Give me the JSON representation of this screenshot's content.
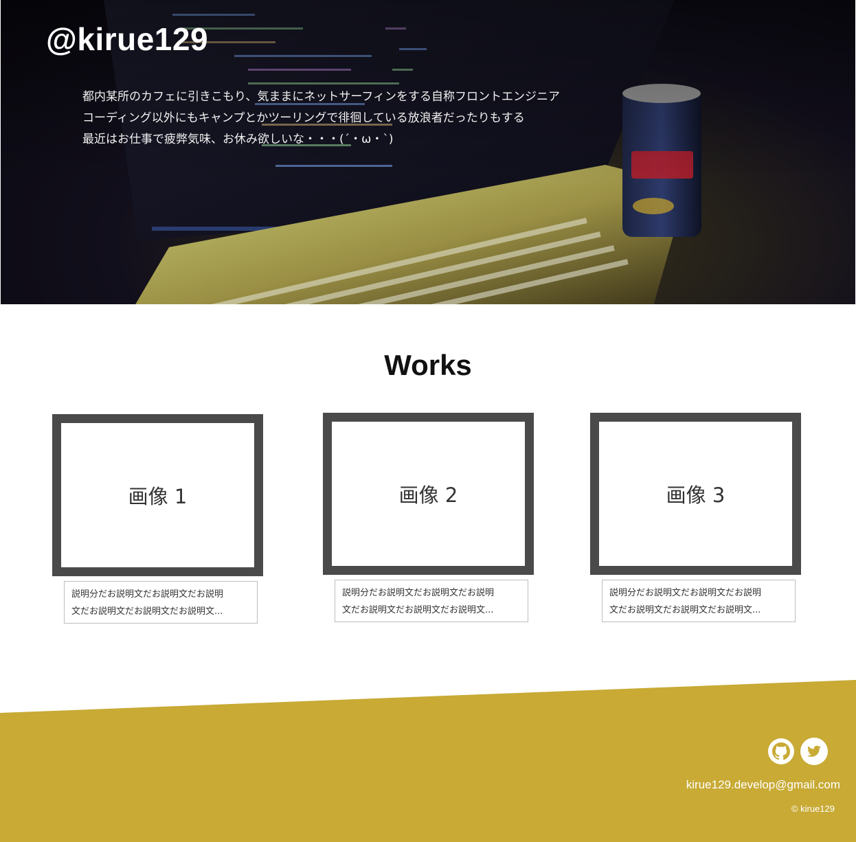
{
  "header": {
    "site_title": "@kirue129",
    "intro_lines": [
      "都内某所のカフェに引きこもり、気ままにネットサーフィンをする自称フロントエンジニア",
      "コーディング以外にもキャンプとかツーリングで徘徊している放浪者だったりもする",
      "最近はお仕事で疲弊気味、お休み欲しいな・・・(´・ω・`)"
    ]
  },
  "works": {
    "heading": "Works",
    "items": [
      {
        "image_label": "画像 1",
        "desc_line1": "説明分だお説明文だお説明文だお説明",
        "desc_line2": "文だお説明文だお説明文だお説明文..."
      },
      {
        "image_label": "画像 2",
        "desc_line1": "説明分だお説明文だお説明文だお説明",
        "desc_line2": "文だお説明文だお説明文だお説明文..."
      },
      {
        "image_label": "画像 3",
        "desc_line1": "説明分だお説明文だお説明文だお説明",
        "desc_line2": "文だお説明文だお説明文だお説明文..."
      }
    ]
  },
  "footer": {
    "social": [
      {
        "icon": "github-icon"
      },
      {
        "icon": "twitter-icon"
      }
    ],
    "email": "kirue129.develop@gmail.com",
    "copyright": "© kirue129"
  },
  "colors": {
    "footer_bg": "#c8aa35",
    "frame_border": "#4a4a4a",
    "hero_dark": "#0b0a12"
  }
}
